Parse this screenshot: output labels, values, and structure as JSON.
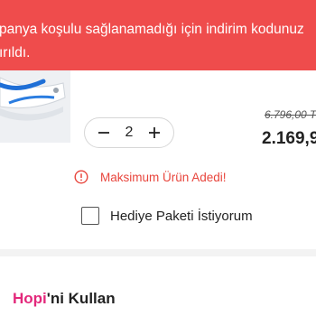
{
  "alert": {
    "line1": "panya koşulu sağlanamadığı için indirim kodunuz",
    "line2": "ırıldı."
  },
  "product": {
    "quantity": "2",
    "old_price": "6.796,00 T",
    "new_price": "2.169,9"
  },
  "warning": {
    "text": "Maksimum Ürün Adedi!"
  },
  "gift": {
    "label": "Hediye Paketi İstiyorum"
  },
  "hopi": {
    "brand": "Hopi",
    "rest": "'ni Kullan"
  },
  "colors": {
    "alert_bg": "#ef4c4c",
    "warning": "#e8453c",
    "hopi_brand": "#e3287b"
  }
}
